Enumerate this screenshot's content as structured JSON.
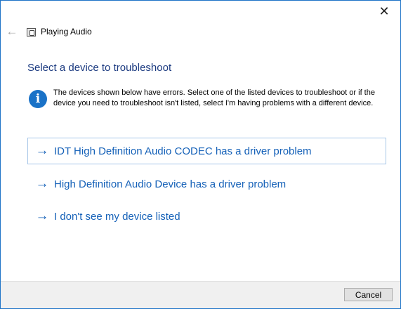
{
  "window": {
    "close_label": "✕"
  },
  "nav": {
    "back_label": "←",
    "title": "Playing Audio"
  },
  "heading": "Select a device to troubleshoot",
  "info": {
    "icon": "i",
    "text": "The devices shown below have errors. Select one of the listed devices to troubleshoot or if the device you need to troubleshoot isn't listed, select I'm having problems with a different device."
  },
  "options": [
    {
      "arrow": "→",
      "label": "IDT High Definition Audio CODEC has a driver problem"
    },
    {
      "arrow": "→",
      "label": "High Definition Audio Device has a driver problem"
    },
    {
      "arrow": "→",
      "label": "I don't see my device listed"
    }
  ],
  "footer": {
    "cancel_label": "Cancel"
  },
  "colors": {
    "accent": "#1561b8",
    "heading": "#1b3a80",
    "info_icon": "#1a72c7"
  }
}
